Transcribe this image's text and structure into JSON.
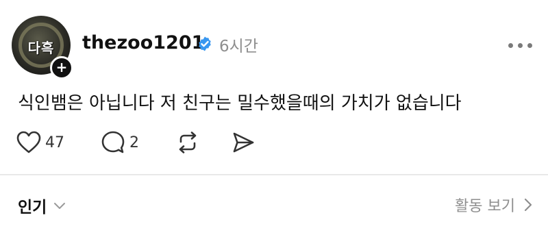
{
  "post": {
    "avatar_text": "다흑",
    "username": "thezoo1201",
    "verified_icon": "verified-badge-icon",
    "time": "6시간",
    "body": "식인뱀은 아닙니다 저 친구는 밀수했을때의 가치가 없습니다",
    "likes": "47",
    "comments": "2"
  },
  "footer": {
    "sort_label": "인기",
    "activity_label": "활동 보기"
  },
  "colors": {
    "verified": "#3897f0",
    "muted": "#8e8e8e",
    "text": "#111111"
  }
}
